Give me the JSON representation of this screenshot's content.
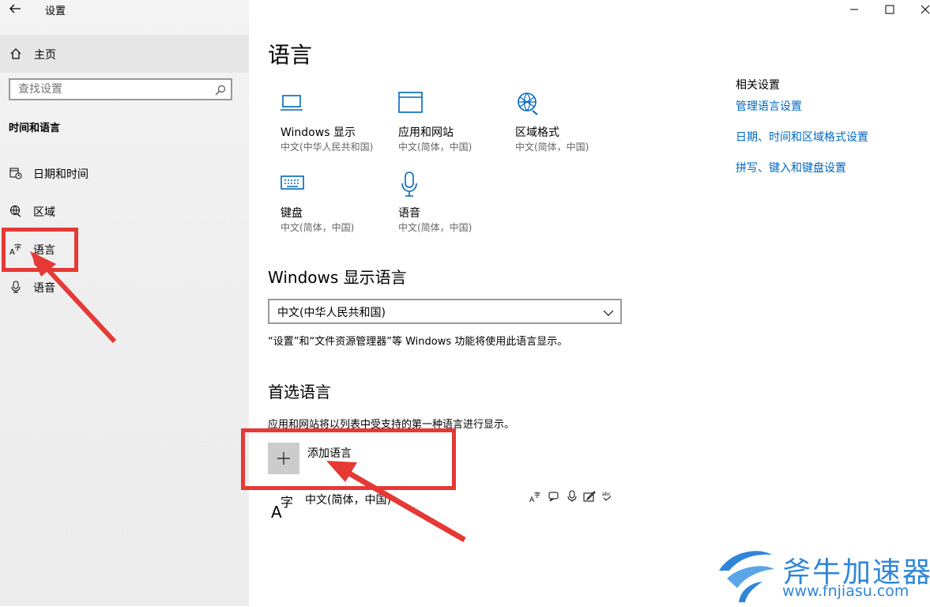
{
  "window": {
    "title": "设置"
  },
  "sidebar": {
    "home_label": "主页",
    "search_placeholder": "查找设置",
    "section_title": "时间和语言",
    "items": [
      {
        "label": "日期和时间",
        "icon": "calendar-clock-icon"
      },
      {
        "label": "区域",
        "icon": "region-globe-icon"
      },
      {
        "label": "语言",
        "icon": "language-icon"
      },
      {
        "label": "语音",
        "icon": "microphone-icon"
      }
    ]
  },
  "main": {
    "title": "语言",
    "tiles": [
      {
        "name": "Windows 显示",
        "sub": "中文(中华人民共和国)",
        "icon": "display-icon"
      },
      {
        "name": "应用和网站",
        "sub": "中文(简体，中国)",
        "icon": "window-icon"
      },
      {
        "name": "区域格式",
        "sub": "中文(简体，中国)",
        "icon": "globe-icon"
      },
      {
        "name": "键盘",
        "sub": "中文(简体，中国)",
        "icon": "keyboard-icon"
      },
      {
        "name": "语音",
        "sub": "中文(简体，中国)",
        "icon": "microphone-icon"
      }
    ],
    "display_language": {
      "heading": "Windows 显示语言",
      "selected": "中文(中华人民共和国)",
      "description": "“设置”和“文件资源管理器”等 Windows 功能将使用此语言显示。"
    },
    "preferred": {
      "heading": "首选语言",
      "description": "应用和网站将以列表中受支持的第一种语言进行显示。",
      "add_label": "添加语言",
      "languages": [
        {
          "label": "中文(简体，中国)"
        }
      ]
    }
  },
  "related": {
    "title": "相关设置",
    "links": [
      "管理语言设置",
      "日期、时间和区域格式设置",
      "拼写、键入和键盘设置"
    ]
  },
  "watermark": {
    "brand": "斧牛加速器",
    "url": "www.fnjiasu.com"
  },
  "colors": {
    "accent": "#0067c0",
    "annotation": "#e53935",
    "watermark": "#2f86d8"
  }
}
